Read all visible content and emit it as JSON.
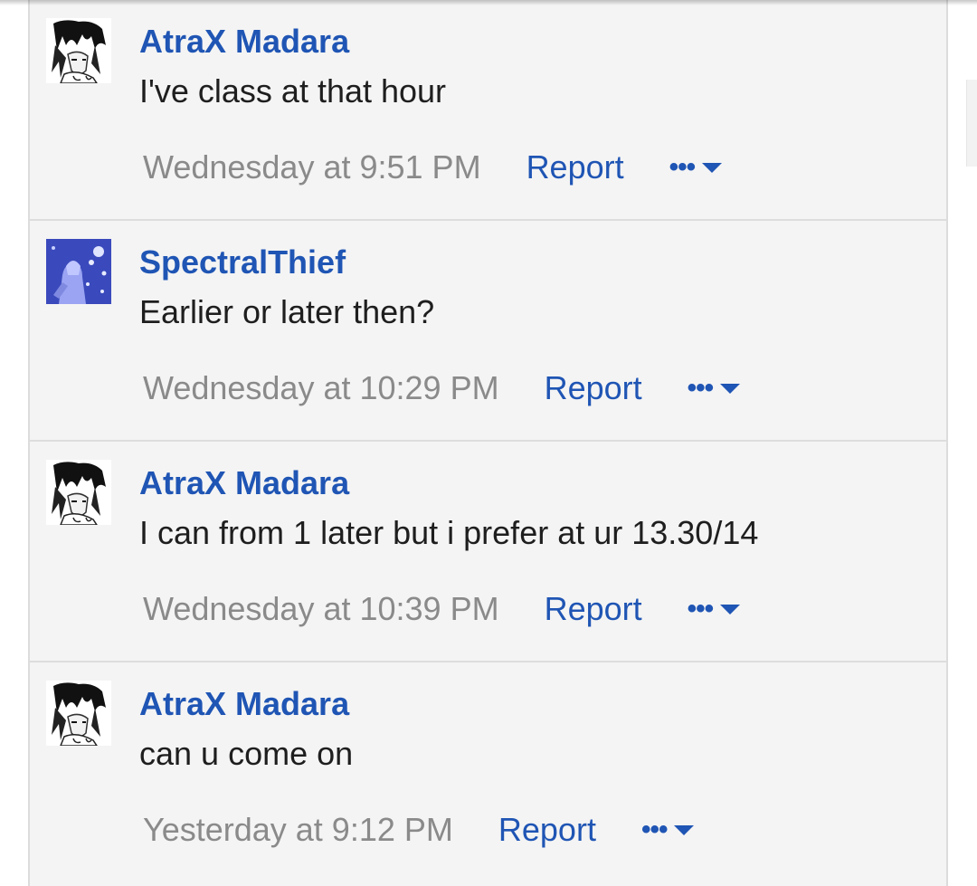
{
  "messages": [
    {
      "username": "AtraX Madara",
      "text": "I've class at that hour",
      "timestamp": "Wednesday at 9:51 PM",
      "report_label": "Report",
      "more_label": "•••",
      "avatar": "manga-portrait-avatar"
    },
    {
      "username": "SpectralThief",
      "text": "Earlier or later then?",
      "timestamp": "Wednesday at 10:29 PM",
      "report_label": "Report",
      "more_label": "•••",
      "avatar": "blue-figure-avatar"
    },
    {
      "username": "AtraX Madara",
      "text": "I can from 1 later but i prefer at ur 13.30/14",
      "timestamp": "Wednesday at 10:39 PM",
      "report_label": "Report",
      "more_label": "•••",
      "avatar": "manga-portrait-avatar"
    },
    {
      "username": "AtraX Madara",
      "text": "can u come on",
      "timestamp": "Yesterday at 9:12 PM",
      "report_label": "Report",
      "more_label": "•••",
      "avatar": "manga-portrait-avatar"
    }
  ],
  "colors": {
    "username": "#1f55b4",
    "link": "#1f55b4",
    "timestamp": "#8a8a8a",
    "text": "#1e1e1e",
    "panel_background": "#f4f4f4"
  }
}
